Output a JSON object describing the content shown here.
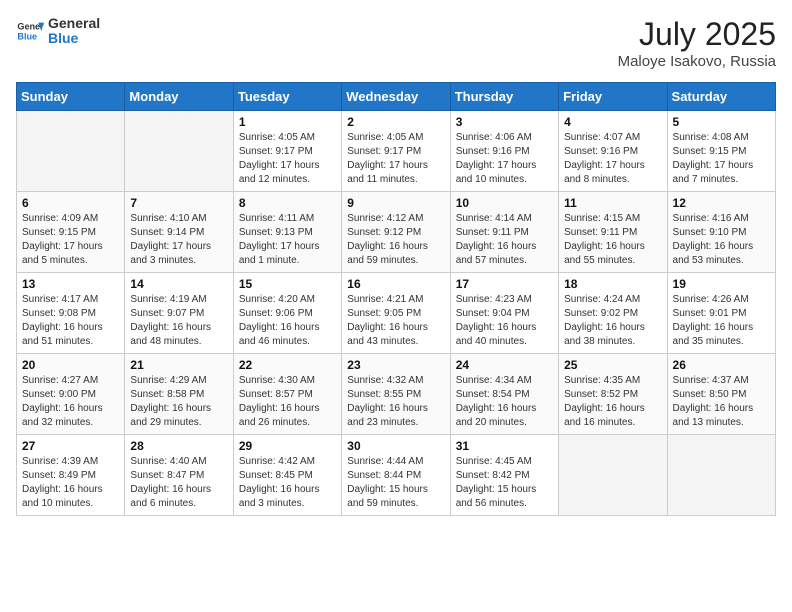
{
  "logo": {
    "line1": "General",
    "line2": "Blue"
  },
  "title": {
    "month_year": "July 2025",
    "location": "Maloye Isakovo, Russia"
  },
  "weekdays": [
    "Sunday",
    "Monday",
    "Tuesday",
    "Wednesday",
    "Thursday",
    "Friday",
    "Saturday"
  ],
  "weeks": [
    [
      {
        "day": "",
        "info": ""
      },
      {
        "day": "",
        "info": ""
      },
      {
        "day": "1",
        "info": "Sunrise: 4:05 AM\nSunset: 9:17 PM\nDaylight: 17 hours and 12 minutes."
      },
      {
        "day": "2",
        "info": "Sunrise: 4:05 AM\nSunset: 9:17 PM\nDaylight: 17 hours and 11 minutes."
      },
      {
        "day": "3",
        "info": "Sunrise: 4:06 AM\nSunset: 9:16 PM\nDaylight: 17 hours and 10 minutes."
      },
      {
        "day": "4",
        "info": "Sunrise: 4:07 AM\nSunset: 9:16 PM\nDaylight: 17 hours and 8 minutes."
      },
      {
        "day": "5",
        "info": "Sunrise: 4:08 AM\nSunset: 9:15 PM\nDaylight: 17 hours and 7 minutes."
      }
    ],
    [
      {
        "day": "6",
        "info": "Sunrise: 4:09 AM\nSunset: 9:15 PM\nDaylight: 17 hours and 5 minutes."
      },
      {
        "day": "7",
        "info": "Sunrise: 4:10 AM\nSunset: 9:14 PM\nDaylight: 17 hours and 3 minutes."
      },
      {
        "day": "8",
        "info": "Sunrise: 4:11 AM\nSunset: 9:13 PM\nDaylight: 17 hours and 1 minute."
      },
      {
        "day": "9",
        "info": "Sunrise: 4:12 AM\nSunset: 9:12 PM\nDaylight: 16 hours and 59 minutes."
      },
      {
        "day": "10",
        "info": "Sunrise: 4:14 AM\nSunset: 9:11 PM\nDaylight: 16 hours and 57 minutes."
      },
      {
        "day": "11",
        "info": "Sunrise: 4:15 AM\nSunset: 9:11 PM\nDaylight: 16 hours and 55 minutes."
      },
      {
        "day": "12",
        "info": "Sunrise: 4:16 AM\nSunset: 9:10 PM\nDaylight: 16 hours and 53 minutes."
      }
    ],
    [
      {
        "day": "13",
        "info": "Sunrise: 4:17 AM\nSunset: 9:08 PM\nDaylight: 16 hours and 51 minutes."
      },
      {
        "day": "14",
        "info": "Sunrise: 4:19 AM\nSunset: 9:07 PM\nDaylight: 16 hours and 48 minutes."
      },
      {
        "day": "15",
        "info": "Sunrise: 4:20 AM\nSunset: 9:06 PM\nDaylight: 16 hours and 46 minutes."
      },
      {
        "day": "16",
        "info": "Sunrise: 4:21 AM\nSunset: 9:05 PM\nDaylight: 16 hours and 43 minutes."
      },
      {
        "day": "17",
        "info": "Sunrise: 4:23 AM\nSunset: 9:04 PM\nDaylight: 16 hours and 40 minutes."
      },
      {
        "day": "18",
        "info": "Sunrise: 4:24 AM\nSunset: 9:02 PM\nDaylight: 16 hours and 38 minutes."
      },
      {
        "day": "19",
        "info": "Sunrise: 4:26 AM\nSunset: 9:01 PM\nDaylight: 16 hours and 35 minutes."
      }
    ],
    [
      {
        "day": "20",
        "info": "Sunrise: 4:27 AM\nSunset: 9:00 PM\nDaylight: 16 hours and 32 minutes."
      },
      {
        "day": "21",
        "info": "Sunrise: 4:29 AM\nSunset: 8:58 PM\nDaylight: 16 hours and 29 minutes."
      },
      {
        "day": "22",
        "info": "Sunrise: 4:30 AM\nSunset: 8:57 PM\nDaylight: 16 hours and 26 minutes."
      },
      {
        "day": "23",
        "info": "Sunrise: 4:32 AM\nSunset: 8:55 PM\nDaylight: 16 hours and 23 minutes."
      },
      {
        "day": "24",
        "info": "Sunrise: 4:34 AM\nSunset: 8:54 PM\nDaylight: 16 hours and 20 minutes."
      },
      {
        "day": "25",
        "info": "Sunrise: 4:35 AM\nSunset: 8:52 PM\nDaylight: 16 hours and 16 minutes."
      },
      {
        "day": "26",
        "info": "Sunrise: 4:37 AM\nSunset: 8:50 PM\nDaylight: 16 hours and 13 minutes."
      }
    ],
    [
      {
        "day": "27",
        "info": "Sunrise: 4:39 AM\nSunset: 8:49 PM\nDaylight: 16 hours and 10 minutes."
      },
      {
        "day": "28",
        "info": "Sunrise: 4:40 AM\nSunset: 8:47 PM\nDaylight: 16 hours and 6 minutes."
      },
      {
        "day": "29",
        "info": "Sunrise: 4:42 AM\nSunset: 8:45 PM\nDaylight: 16 hours and 3 minutes."
      },
      {
        "day": "30",
        "info": "Sunrise: 4:44 AM\nSunset: 8:44 PM\nDaylight: 15 hours and 59 minutes."
      },
      {
        "day": "31",
        "info": "Sunrise: 4:45 AM\nSunset: 8:42 PM\nDaylight: 15 hours and 56 minutes."
      },
      {
        "day": "",
        "info": ""
      },
      {
        "day": "",
        "info": ""
      }
    ]
  ]
}
